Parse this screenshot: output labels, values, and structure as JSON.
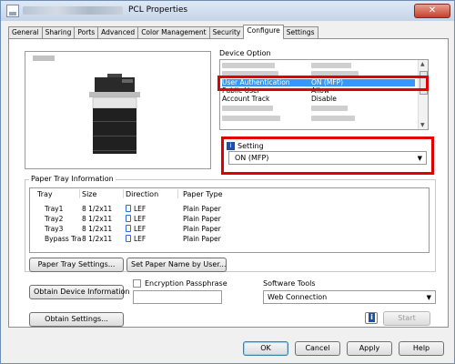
{
  "window": {
    "title": "PCL Properties",
    "close_label": "✕"
  },
  "tabs": [
    "General",
    "Sharing",
    "Ports",
    "Advanced",
    "Color Management",
    "Security",
    "Configure",
    "Settings"
  ],
  "device_option": {
    "label": "Device Option",
    "rows": [
      {
        "key": "User Authentication",
        "value": "ON (MFP)",
        "selected": true
      },
      {
        "key": "Public User",
        "value": "Allow",
        "selected": false
      },
      {
        "key": "Account Track",
        "value": "Disable",
        "selected": false
      }
    ]
  },
  "setting": {
    "label": "Setting",
    "value": "ON (MFP)"
  },
  "printer_trays": [
    "1",
    "2",
    "3"
  ],
  "paper_tray_info": {
    "label": "Paper Tray Information",
    "columns": [
      "Tray",
      "Size",
      "Direction",
      "Paper Type"
    ],
    "rows": [
      {
        "tray": "Tray1",
        "size": "8 1/2x11",
        "direction": "LEF",
        "type": "Plain Paper"
      },
      {
        "tray": "Tray2",
        "size": "8 1/2x11",
        "direction": "LEF",
        "type": "Plain Paper"
      },
      {
        "tray": "Tray3",
        "size": "8 1/2x11",
        "direction": "LEF",
        "type": "Plain Paper"
      },
      {
        "tray": "Bypass Tra",
        "size": "8 1/2x11",
        "direction": "LEF",
        "type": "Plain Paper"
      }
    ]
  },
  "buttons": {
    "paper_tray_settings": "Paper Tray Settings...",
    "set_paper_name": "Set Paper Name by User...",
    "obtain_device_info": "Obtain Device Information",
    "obtain_settings": "Obtain Settings...",
    "start": "Start",
    "ok": "OK",
    "cancel": "Cancel",
    "apply": "Apply",
    "help": "Help"
  },
  "encryption": {
    "label": "Encryption Passphrase",
    "value": ""
  },
  "software_tools": {
    "label": "Software Tools",
    "value": "Web Connection"
  },
  "colors": {
    "highlight": "#3399ff",
    "annotation_red": "#e00000"
  }
}
